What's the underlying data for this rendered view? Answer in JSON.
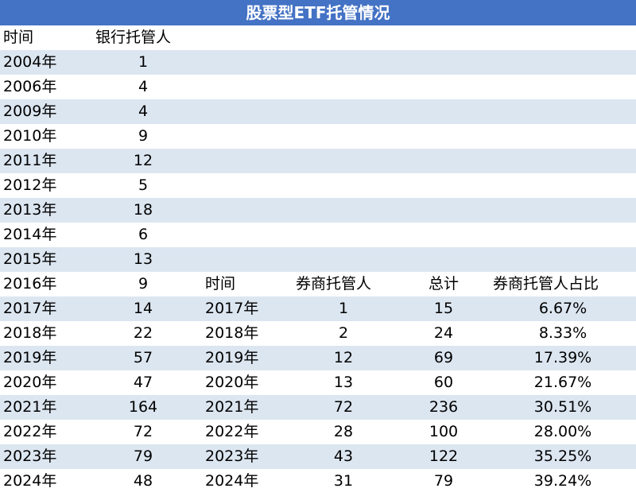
{
  "title": "股票型ETF托管情况",
  "bank_header": {
    "time": "时间",
    "bank": "银行托管人"
  },
  "broker_header": {
    "time": "时间",
    "broker": "券商托管人",
    "total": "总计",
    "ratio": "券商托管人占比"
  },
  "rows": [
    {
      "year": "2004年",
      "bank": "1"
    },
    {
      "year": "2006年",
      "bank": "4"
    },
    {
      "year": "2009年",
      "bank": "4"
    },
    {
      "year": "2010年",
      "bank": "9"
    },
    {
      "year": "2011年",
      "bank": "12"
    },
    {
      "year": "2012年",
      "bank": "5"
    },
    {
      "year": "2013年",
      "bank": "18"
    },
    {
      "year": "2014年",
      "bank": "6"
    },
    {
      "year": "2015年",
      "bank": "13"
    },
    {
      "year": "2016年",
      "bank": "9"
    },
    {
      "year": "2017年",
      "bank": "14",
      "year2": "2017年",
      "broker": "1",
      "total": "15",
      "ratio": "6.67%"
    },
    {
      "year": "2018年",
      "bank": "22",
      "year2": "2018年",
      "broker": "2",
      "total": "24",
      "ratio": "8.33%"
    },
    {
      "year": "2019年",
      "bank": "57",
      "year2": "2019年",
      "broker": "12",
      "total": "69",
      "ratio": "17.39%"
    },
    {
      "year": "2020年",
      "bank": "47",
      "year2": "2020年",
      "broker": "13",
      "total": "60",
      "ratio": "21.67%"
    },
    {
      "year": "2021年",
      "bank": "164",
      "year2": "2021年",
      "broker": "72",
      "total": "236",
      "ratio": "30.51%"
    },
    {
      "year": "2022年",
      "bank": "72",
      "year2": "2022年",
      "broker": "28",
      "total": "100",
      "ratio": "28.00%"
    },
    {
      "year": "2023年",
      "bank": "79",
      "year2": "2023年",
      "broker": "43",
      "total": "122",
      "ratio": "35.25%"
    },
    {
      "year": "2024年",
      "bank": "48",
      "year2": "2024年",
      "broker": "31",
      "total": "79",
      "ratio": "39.24%"
    }
  ],
  "colors": {
    "header_bg": "#4472C4",
    "band": "#DCE6F1"
  }
}
